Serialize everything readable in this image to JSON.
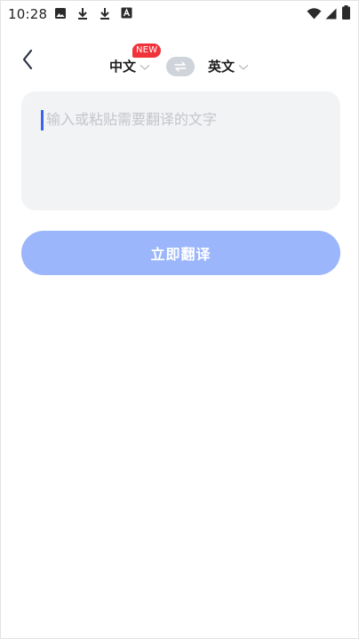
{
  "status_bar": {
    "time": "10:28",
    "left_icons": [
      "image-icon",
      "download-icon",
      "download-icon",
      "font-a-icon"
    ],
    "right_icons": [
      "wifi-icon",
      "signal-icon",
      "battery-icon"
    ]
  },
  "header": {
    "back_icon": "chevron-left-icon",
    "source_language": "中文",
    "new_badge": "NEW",
    "swap_icon": "swap-arrows-icon",
    "target_language": "英文",
    "chevron_icon": "chevron-down-icon"
  },
  "input": {
    "placeholder": "输入或粘贴需要翻译的文字",
    "value": "",
    "cursor_color": "#3a63f0"
  },
  "action": {
    "translate_label": "立即翻译",
    "button_color": "#9bb6fb"
  },
  "colors": {
    "badge": "#f0333b",
    "swap_bg": "#cfd3da",
    "card_bg": "#f2f3f5"
  }
}
